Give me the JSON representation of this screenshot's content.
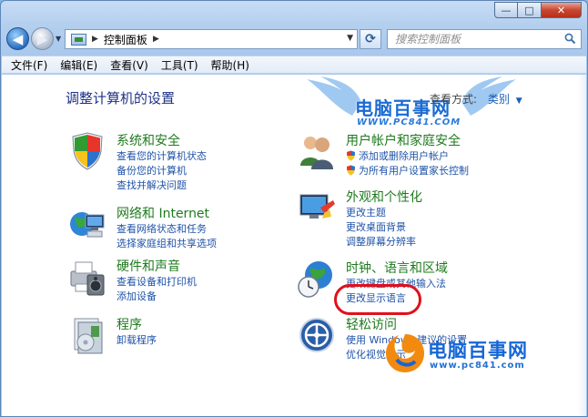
{
  "window": {
    "title_buttons": {
      "minimize": "—",
      "maximize": "□",
      "close": "✕"
    }
  },
  "navigation": {
    "breadcrumb": "控制面板",
    "search_placeholder": "搜索控制面板"
  },
  "menu": [
    "文件(F)",
    "编辑(E)",
    "查看(V)",
    "工具(T)",
    "帮助(H)"
  ],
  "page": {
    "title": "调整计算机的设置",
    "view_by_label": "查看方式:",
    "view_by_value": "类别"
  },
  "categories": {
    "system": {
      "title": "系统和安全",
      "links": [
        "查看您的计算机状态",
        "备份您的计算机",
        "查找并解决问题"
      ]
    },
    "network": {
      "title": "网络和 Internet",
      "links": [
        "查看网络状态和任务",
        "选择家庭组和共享选项"
      ]
    },
    "hardware": {
      "title": "硬件和声音",
      "links": [
        "查看设备和打印机",
        "添加设备"
      ]
    },
    "programs": {
      "title": "程序",
      "links": [
        "卸载程序"
      ]
    },
    "users": {
      "title": "用户帐户和家庭安全",
      "links": [
        "添加或删除用户帐户",
        "为所有用户设置家长控制"
      ]
    },
    "appearance": {
      "title": "外观和个性化",
      "links": [
        "更改主题",
        "更改桌面背景",
        "调整屏幕分辨率"
      ]
    },
    "clock": {
      "title": "时钟、语言和区域",
      "links": [
        "更改键盘或其他输入法",
        "更改显示语言"
      ]
    },
    "ease": {
      "title": "轻松访问",
      "links": [
        "使用 Windows 建议的设置",
        "优化视觉显示"
      ]
    }
  },
  "watermark": {
    "brand": "电脑百事网",
    "url_top": "WWW.PC841.COM",
    "url_bottom": "www.pc841.com"
  },
  "colors": {
    "category_title": "#1e7a1e",
    "link": "#1f53a8",
    "page_title": "#1e3287",
    "highlight": "#e0101b"
  }
}
